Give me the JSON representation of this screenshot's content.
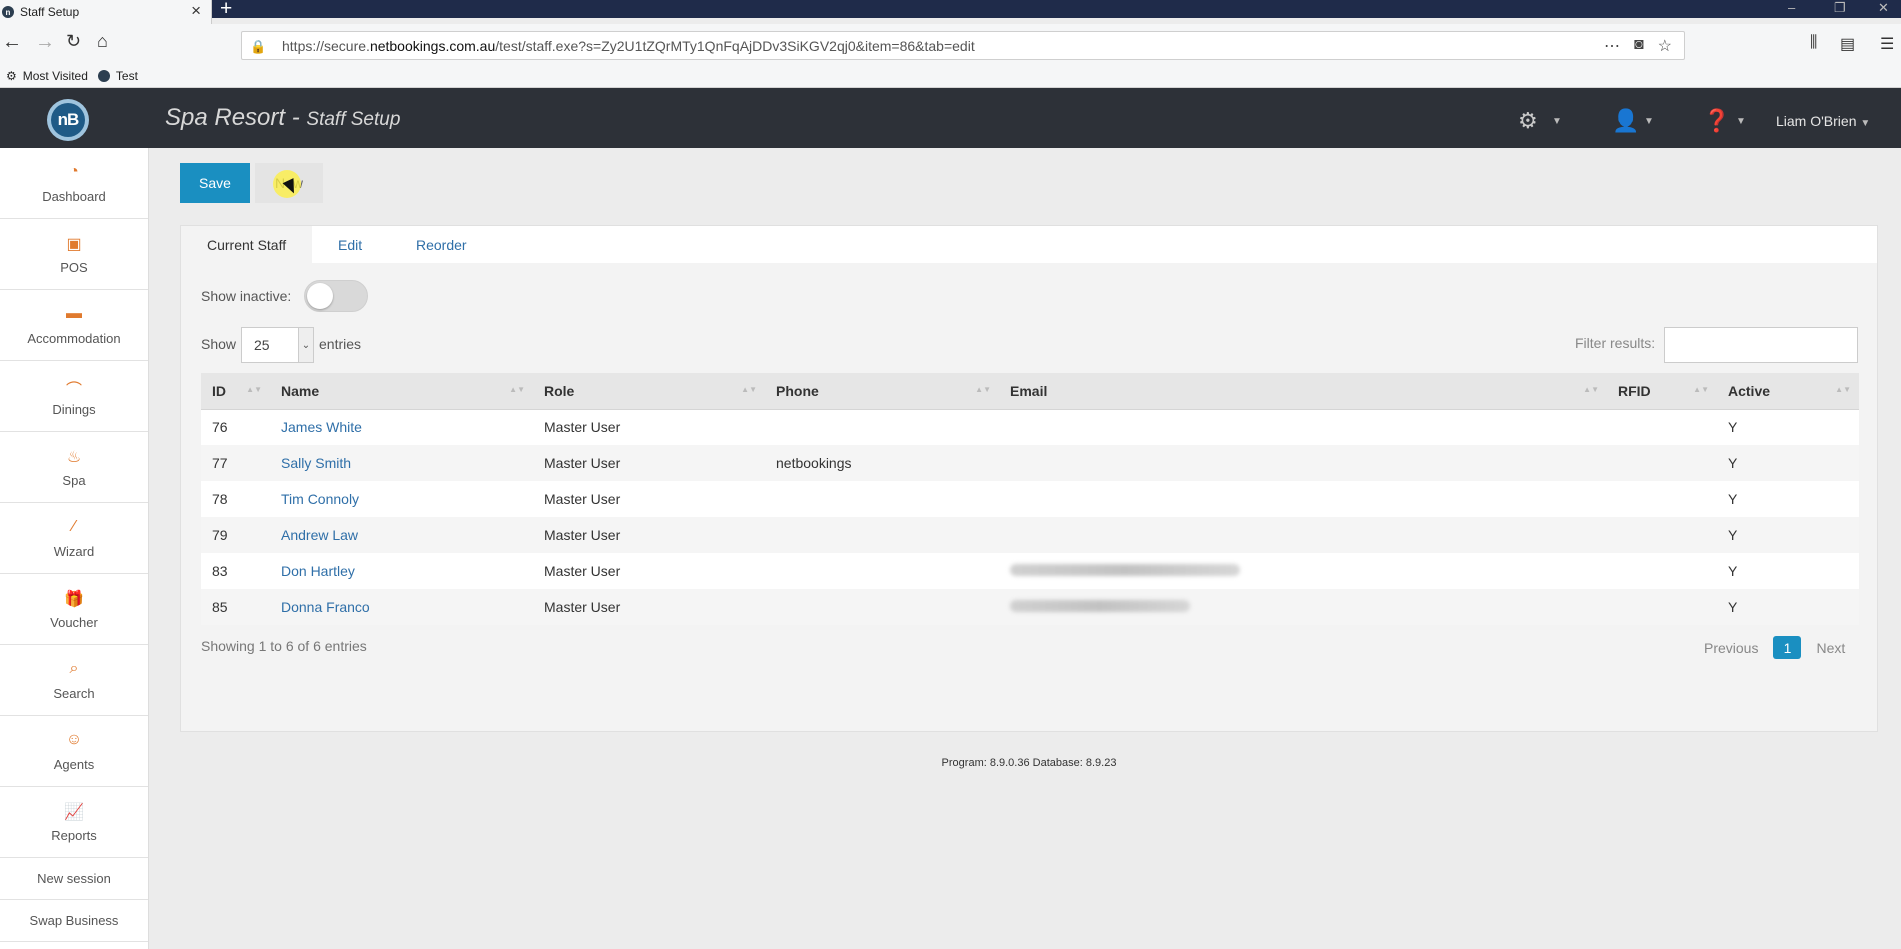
{
  "browser": {
    "tab_title": "Staff Setup",
    "url_host": "https://secure.",
    "url_domain": "netbookings.com.au",
    "url_path": "/test/staff.exe?s=Zy2U1tZQrMTy1QnFqAjDDv3SiKGV2qj0&item=86&tab=edit",
    "bookmarks": [
      "Most Visited",
      "Test"
    ]
  },
  "header": {
    "logo_text": "nB",
    "title": "Spa Resort",
    "separator": " - ",
    "subtitle": "Staff Setup",
    "user_name": "Liam O'Brien"
  },
  "sidebar": {
    "items": [
      {
        "label": "Dashboard",
        "icon": "dashboard-icon"
      },
      {
        "label": "POS",
        "icon": "pos-icon"
      },
      {
        "label": "Accommodation",
        "icon": "bed-icon"
      },
      {
        "label": "Dinings",
        "icon": "dining-icon"
      },
      {
        "label": "Spa",
        "icon": "spa-icon"
      },
      {
        "label": "Wizard",
        "icon": "wand-icon"
      },
      {
        "label": "Voucher",
        "icon": "gift-icon"
      },
      {
        "label": "Search",
        "icon": "search-icon"
      },
      {
        "label": "Agents",
        "icon": "agent-icon"
      },
      {
        "label": "Reports",
        "icon": "chart-icon"
      }
    ],
    "new_session": "New session",
    "swap_business": "Swap Business"
  },
  "toolbar": {
    "save_label": "Save",
    "new_label": "New"
  },
  "tabs": [
    "Current Staff",
    "Edit",
    "Reorder"
  ],
  "controls": {
    "show_inactive_label": "Show inactive:",
    "show_label": "Show",
    "entries_value": "25",
    "entries_label": "entries",
    "filter_label": "Filter results:"
  },
  "table": {
    "columns": [
      "ID",
      "Name",
      "Role",
      "Phone",
      "Email",
      "RFID",
      "Active"
    ],
    "rows": [
      {
        "id": "76",
        "name": "James White",
        "role": "Master User",
        "phone": "",
        "active": "Y"
      },
      {
        "id": "77",
        "name": "Sally Smith",
        "role": "Master User",
        "phone": "netbookings",
        "active": "Y"
      },
      {
        "id": "78",
        "name": "Tim Connoly",
        "role": "Master User",
        "phone": "",
        "active": "Y"
      },
      {
        "id": "79",
        "name": "Andrew Law",
        "role": "Master User",
        "phone": "",
        "active": "Y"
      },
      {
        "id": "83",
        "name": "Don Hartley",
        "role": "Master User",
        "phone": "",
        "active": "Y"
      },
      {
        "id": "85",
        "name": "Donna Franco",
        "role": "Master User",
        "phone": "",
        "active": "Y"
      }
    ]
  },
  "pagination": {
    "summary": "Showing 1 to 6 of 6 entries",
    "previous": "Previous",
    "current": "1",
    "next": "Next"
  },
  "footer": {
    "version": "Program: 8.9.0.36 Database: 8.9.23"
  },
  "colors": {
    "accent": "#1a8fc1",
    "header_bg": "#2d3138",
    "sidebar_icon": "#e07a2e",
    "link": "#2f6fa8"
  }
}
